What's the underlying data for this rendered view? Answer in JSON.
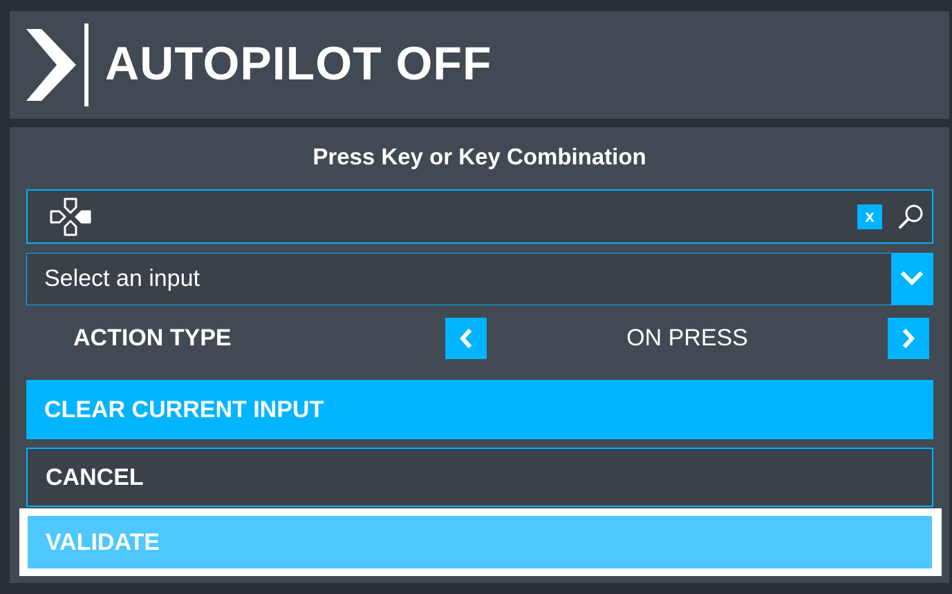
{
  "header": {
    "title": "AUTOPILOT OFF"
  },
  "dialog": {
    "prompt": "Press Key or Key Combination",
    "search": {
      "clear_label": "x"
    },
    "select": {
      "value": "Select an input"
    },
    "action_type": {
      "label": "ACTION TYPE",
      "value": "ON PRESS"
    },
    "buttons": {
      "clear_current_input": "CLEAR CURRENT INPUT",
      "cancel": "CANCEL",
      "validate": "VALIDATE"
    }
  },
  "icons": {
    "logo": "chevron-right-bar-logo",
    "gamepad": "dpad-icon",
    "search": "search-icon",
    "dropdown": "chevron-down-icon",
    "prev": "chevron-left-icon",
    "next": "chevron-right-icon"
  },
  "colors": {
    "accent": "#00b4ff",
    "accent_light": "#4ec8ff",
    "panel": "#414952",
    "background": "#2a2f35"
  }
}
